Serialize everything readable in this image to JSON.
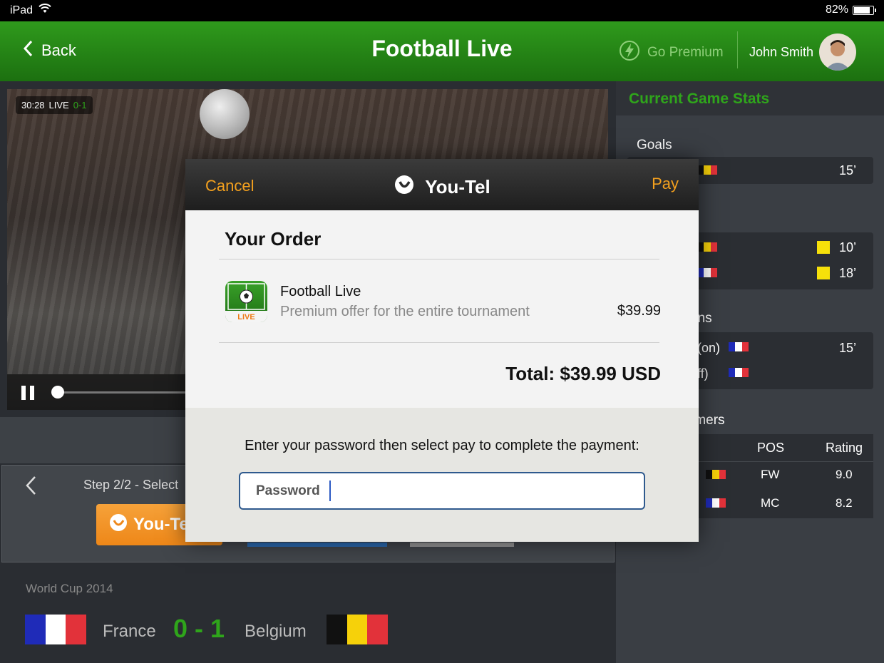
{
  "status_bar": {
    "device": "iPad",
    "battery": "82%"
  },
  "header": {
    "back_label": "Back",
    "title": "Football Live",
    "premium_label": "Go Premium",
    "user_name": "John Smith"
  },
  "video": {
    "time": "30:28",
    "live": "LIVE",
    "score": "0-1"
  },
  "step": {
    "label": "Step 2/2 - Select",
    "youtel_label": "You-Te"
  },
  "match": {
    "competition": "World Cup 2014",
    "team_home": "France",
    "team_away": "Belgium",
    "score": "0 - 1"
  },
  "stats": {
    "title": "Current Game Stats",
    "goals_label": "Goals",
    "goal_minute": "15’",
    "cards": [
      {
        "minute": "10’"
      },
      {
        "minute": "18’"
      }
    ],
    "subs_label": "ons",
    "subs": [
      {
        "label": "(on)",
        "minute": "15’"
      },
      {
        "label": "ff)"
      }
    ],
    "performers_label": "rmers",
    "col_pos": "POS",
    "col_rating": "Rating",
    "performers": [
      {
        "pos": "FW",
        "rating": "9.0"
      },
      {
        "pos": "MC",
        "rating": "8.2"
      }
    ]
  },
  "modal": {
    "cancel": "Cancel",
    "brand": "You-Tel",
    "pay": "Pay",
    "order_title": "Your Order",
    "item_name": "Football Live",
    "item_desc": "Premium offer for the entire tournament",
    "item_price": "$39.99",
    "icon_badge": "LIVE",
    "total": "Total: $39.99 USD",
    "instruction": "Enter your password then select pay to complete the payment:",
    "password_placeholder": "Password"
  },
  "colors": {
    "header_green": "#2f9a1c",
    "accent_orange": "#f3a01e",
    "score_green": "#2fa51b",
    "france": [
      "#1f2bb8",
      "#ffffff",
      "#e2323a"
    ],
    "belgium": [
      "#111111",
      "#f6d10a",
      "#e2323a"
    ]
  }
}
